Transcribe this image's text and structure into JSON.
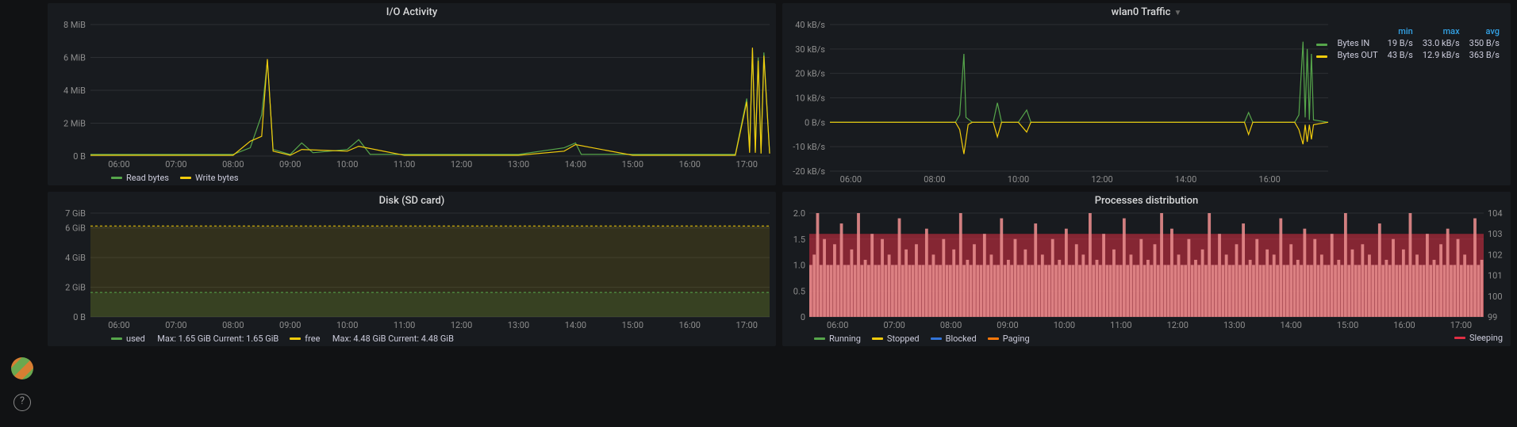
{
  "sidebar": {
    "help_tooltip": "Help"
  },
  "panels": {
    "io": {
      "title": "I/O Activity",
      "legend": {
        "read": "Read bytes",
        "write": "Write bytes"
      },
      "colors": {
        "read": "#56a64b",
        "write": "#f2cc0c"
      }
    },
    "traffic": {
      "title": "wlan0 Traffic",
      "legend": {
        "in": "Bytes IN",
        "out": "Bytes OUT"
      },
      "colors": {
        "in": "#56a64b",
        "out": "#f2cc0c"
      },
      "table": {
        "headers": {
          "min": "min",
          "max": "max",
          "avg": "avg"
        },
        "rows": [
          {
            "name": "Bytes IN",
            "min": "19 B/s",
            "max": "33.0 kB/s",
            "avg": "350 B/s"
          },
          {
            "name": "Bytes OUT",
            "min": "43 B/s",
            "max": "12.9 kB/s",
            "avg": "363 B/s"
          }
        ]
      }
    },
    "disk": {
      "title": "Disk (SD card)",
      "legend": {
        "used": "used",
        "used_stats": "Max: 1.65 GiB  Current: 1.65 GiB",
        "free": "free",
        "free_stats": "Max: 4.48 GiB  Current: 4.48 GiB"
      },
      "colors": {
        "used": "#56a64b",
        "free": "#f2cc0c"
      }
    },
    "procs": {
      "title": "Processes distribution",
      "legend": {
        "running": "Running",
        "stopped": "Stopped",
        "blocked": "Blocked",
        "paging": "Paging",
        "sleeping": "Sleeping"
      },
      "colors": {
        "running": "#56a64b",
        "stopped": "#f2cc0c",
        "blocked": "#3274d9",
        "paging": "#ff780a",
        "sleeping": "#e02f44"
      }
    }
  },
  "chart_data": [
    {
      "id": "io",
      "type": "line",
      "title": "I/O Activity",
      "xlabel": "",
      "ylabel": "",
      "y_ticks": [
        "0 B",
        "2 MiB",
        "4 MiB",
        "6 MiB",
        "8 MiB"
      ],
      "ylim": [
        0,
        8
      ],
      "x_ticks": [
        "06:00",
        "07:00",
        "08:00",
        "09:00",
        "10:00",
        "11:00",
        "12:00",
        "13:00",
        "14:00",
        "15:00",
        "16:00",
        "17:00"
      ],
      "xlim": [
        5.5,
        17.4
      ],
      "series": [
        {
          "name": "Read bytes",
          "color": "#56a64b",
          "points": [
            [
              5.5,
              0.1
            ],
            [
              6.0,
              0.1
            ],
            [
              7.0,
              0.1
            ],
            [
              8.0,
              0.1
            ],
            [
              8.3,
              0.5
            ],
            [
              8.5,
              2.5
            ],
            [
              8.6,
              5.8
            ],
            [
              8.7,
              0.4
            ],
            [
              9.0,
              0.1
            ],
            [
              9.2,
              0.8
            ],
            [
              9.4,
              0.2
            ],
            [
              10.0,
              0.4
            ],
            [
              10.2,
              1.0
            ],
            [
              10.4,
              0.1
            ],
            [
              11.0,
              0.1
            ],
            [
              12.0,
              0.1
            ],
            [
              13.0,
              0.1
            ],
            [
              13.8,
              0.5
            ],
            [
              14.0,
              0.8
            ],
            [
              14.1,
              0.1
            ],
            [
              15.0,
              0.1
            ],
            [
              16.0,
              0.1
            ],
            [
              16.6,
              0.1
            ],
            [
              16.8,
              0.1
            ],
            [
              17.0,
              3.5
            ],
            [
              17.05,
              0.3
            ],
            [
              17.1,
              6.5
            ],
            [
              17.15,
              0.3
            ],
            [
              17.2,
              6.0
            ],
            [
              17.25,
              0.2
            ],
            [
              17.3,
              6.3
            ],
            [
              17.4,
              0.2
            ]
          ]
        },
        {
          "name": "Write bytes",
          "color": "#f2cc0c",
          "points": [
            [
              5.5,
              0.05
            ],
            [
              6.0,
              0.05
            ],
            [
              7.0,
              0.05
            ],
            [
              8.0,
              0.05
            ],
            [
              8.3,
              0.9
            ],
            [
              8.5,
              1.2
            ],
            [
              8.6,
              5.9
            ],
            [
              8.7,
              0.3
            ],
            [
              9.0,
              0.05
            ],
            [
              9.2,
              0.4
            ],
            [
              10.0,
              0.3
            ],
            [
              10.2,
              0.6
            ],
            [
              11.0,
              0.05
            ],
            [
              12.0,
              0.05
            ],
            [
              13.0,
              0.05
            ],
            [
              13.8,
              0.3
            ],
            [
              14.0,
              0.7
            ],
            [
              15.0,
              0.05
            ],
            [
              16.0,
              0.05
            ],
            [
              16.8,
              0.05
            ],
            [
              17.0,
              3.3
            ],
            [
              17.05,
              0.2
            ],
            [
              17.1,
              6.6
            ],
            [
              17.15,
              0.2
            ],
            [
              17.2,
              5.8
            ],
            [
              17.25,
              0.15
            ],
            [
              17.3,
              6.1
            ],
            [
              17.4,
              0.15
            ]
          ]
        }
      ]
    },
    {
      "id": "traffic",
      "type": "line",
      "title": "wlan0 Traffic",
      "y_ticks": [
        "-20 kB/s",
        "-10 kB/s",
        "0 B/s",
        "10 kB/s",
        "20 kB/s",
        "30 kB/s",
        "40 kB/s"
      ],
      "ylim": [
        -20,
        40
      ],
      "x_ticks": [
        "06:00",
        "08:00",
        "10:00",
        "12:00",
        "14:00",
        "16:00"
      ],
      "xlim": [
        5.5,
        17.4
      ],
      "series": [
        {
          "name": "Bytes IN",
          "color": "#56a64b",
          "points": [
            [
              5.5,
              0
            ],
            [
              8.5,
              0
            ],
            [
              8.6,
              3
            ],
            [
              8.7,
              28
            ],
            [
              8.75,
              2
            ],
            [
              8.9,
              0
            ],
            [
              9.4,
              0
            ],
            [
              9.5,
              8
            ],
            [
              9.6,
              0
            ],
            [
              10.0,
              0
            ],
            [
              10.2,
              5
            ],
            [
              10.3,
              0
            ],
            [
              10.4,
              0
            ],
            [
              12.0,
              0
            ],
            [
              14.0,
              0
            ],
            [
              15.4,
              0
            ],
            [
              15.5,
              4
            ],
            [
              15.6,
              0
            ],
            [
              16.0,
              0
            ],
            [
              16.6,
              0
            ],
            [
              16.7,
              3
            ],
            [
              16.8,
              33
            ],
            [
              16.85,
              2
            ],
            [
              16.9,
              30
            ],
            [
              16.95,
              1
            ],
            [
              17.0,
              28
            ],
            [
              17.05,
              1
            ],
            [
              17.4,
              0
            ]
          ]
        },
        {
          "name": "Bytes OUT",
          "color": "#f2cc0c",
          "points": [
            [
              5.5,
              0
            ],
            [
              8.5,
              0
            ],
            [
              8.6,
              -3
            ],
            [
              8.7,
              -13
            ],
            [
              8.8,
              -1
            ],
            [
              8.9,
              0
            ],
            [
              9.4,
              0
            ],
            [
              9.5,
              -6
            ],
            [
              9.6,
              0
            ],
            [
              10.0,
              0
            ],
            [
              10.2,
              -4
            ],
            [
              10.3,
              0
            ],
            [
              12.0,
              0
            ],
            [
              14.0,
              0
            ],
            [
              15.4,
              0
            ],
            [
              15.5,
              -5
            ],
            [
              15.6,
              0
            ],
            [
              16.0,
              0
            ],
            [
              16.6,
              0
            ],
            [
              16.7,
              -3
            ],
            [
              16.8,
              -9
            ],
            [
              16.85,
              -1
            ],
            [
              16.9,
              -8
            ],
            [
              16.95,
              -1
            ],
            [
              17.0,
              -7
            ],
            [
              17.05,
              -1
            ],
            [
              17.4,
              0
            ]
          ]
        }
      ]
    },
    {
      "id": "disk",
      "type": "area",
      "title": "Disk (SD card)",
      "y_ticks": [
        "0 B",
        "2 GiB",
        "4 GiB",
        "6 GiB",
        "7 GiB"
      ],
      "ylim": [
        0,
        7
      ],
      "x_ticks": [
        "06:00",
        "07:00",
        "08:00",
        "09:00",
        "10:00",
        "11:00",
        "12:00",
        "13:00",
        "14:00",
        "15:00",
        "16:00",
        "17:00"
      ],
      "xlim": [
        5.5,
        17.4
      ],
      "series": [
        {
          "name": "free",
          "color": "#f2cc0c",
          "value": 6.13
        },
        {
          "name": "used",
          "color": "#56a64b",
          "value": 1.65
        }
      ]
    },
    {
      "id": "procs",
      "type": "bar",
      "title": "Processes distribution",
      "left_ticks": [
        "0",
        "0.5",
        "1.0",
        "1.5",
        "2.0"
      ],
      "left_lim": [
        0,
        2
      ],
      "right_ticks": [
        "99",
        "100",
        "101",
        "102",
        "103",
        "104"
      ],
      "right_lim": [
        99,
        104
      ],
      "x_ticks": [
        "06:00",
        "07:00",
        "08:00",
        "09:00",
        "10:00",
        "11:00",
        "12:00",
        "13:00",
        "14:00",
        "15:00",
        "16:00",
        "17:00"
      ],
      "xlim": [
        5.5,
        17.4
      ],
      "running_samples": [
        1,
        1.2,
        2,
        1,
        1.5,
        1,
        1,
        1.4,
        1,
        1.8,
        1,
        1,
        1.3,
        1,
        2,
        1,
        1.1,
        1,
        1.6,
        1,
        1,
        1.5,
        1,
        1.2,
        1,
        1,
        1.9,
        1,
        1.3,
        1,
        1,
        1.4,
        1,
        1,
        1.7,
        1,
        1.2,
        1,
        1,
        1.5,
        1,
        1,
        1.3,
        1,
        2,
        1,
        1.1,
        1,
        1.4,
        1,
        1,
        1.6,
        1,
        1.2,
        1,
        1,
        1.9,
        1,
        1.1,
        1,
        1.5,
        1,
        1,
        1.3,
        1,
        1,
        1.8,
        1,
        1.2,
        1,
        1,
        1.5,
        1,
        1.1,
        1,
        1.7,
        1,
        1,
        1.4,
        1,
        1.2,
        1,
        2,
        1,
        1.1,
        1,
        1.6,
        1,
        1,
        1.3,
        1,
        1,
        1.9,
        1,
        1.2,
        1,
        1,
        1.5,
        1,
        1.1,
        1,
        1.4,
        1,
        2,
        1,
        1,
        1.7,
        1,
        1.2,
        1,
        1,
        1.5,
        1,
        1.1,
        1,
        1.3,
        1,
        2,
        1,
        1,
        1.6,
        1,
        1.2,
        1,
        1,
        1.4,
        1,
        1.8,
        1,
        1.1,
        1,
        1.5,
        1,
        1,
        1.3,
        1,
        1.2,
        1,
        1.9,
        1,
        1,
        1.4,
        1,
        1.1,
        1,
        1.7,
        1,
        1,
        1.5,
        1,
        1.2,
        1,
        1,
        1.6,
        1,
        1.1,
        1,
        2,
        1,
        1.3,
        1,
        1,
        1.4,
        1,
        1.2,
        1,
        1,
        1.8,
        1,
        1.1,
        1,
        1.5,
        1,
        1,
        1.3,
        1,
        2,
        1,
        1.2,
        1,
        1,
        1.6,
        1,
        1.1,
        1,
        1.4,
        1,
        1.7,
        1,
        1,
        1.5,
        1,
        1.2,
        1,
        1,
        1.9,
        1,
        1.1
      ],
      "sleeping_level": 103
    }
  ]
}
